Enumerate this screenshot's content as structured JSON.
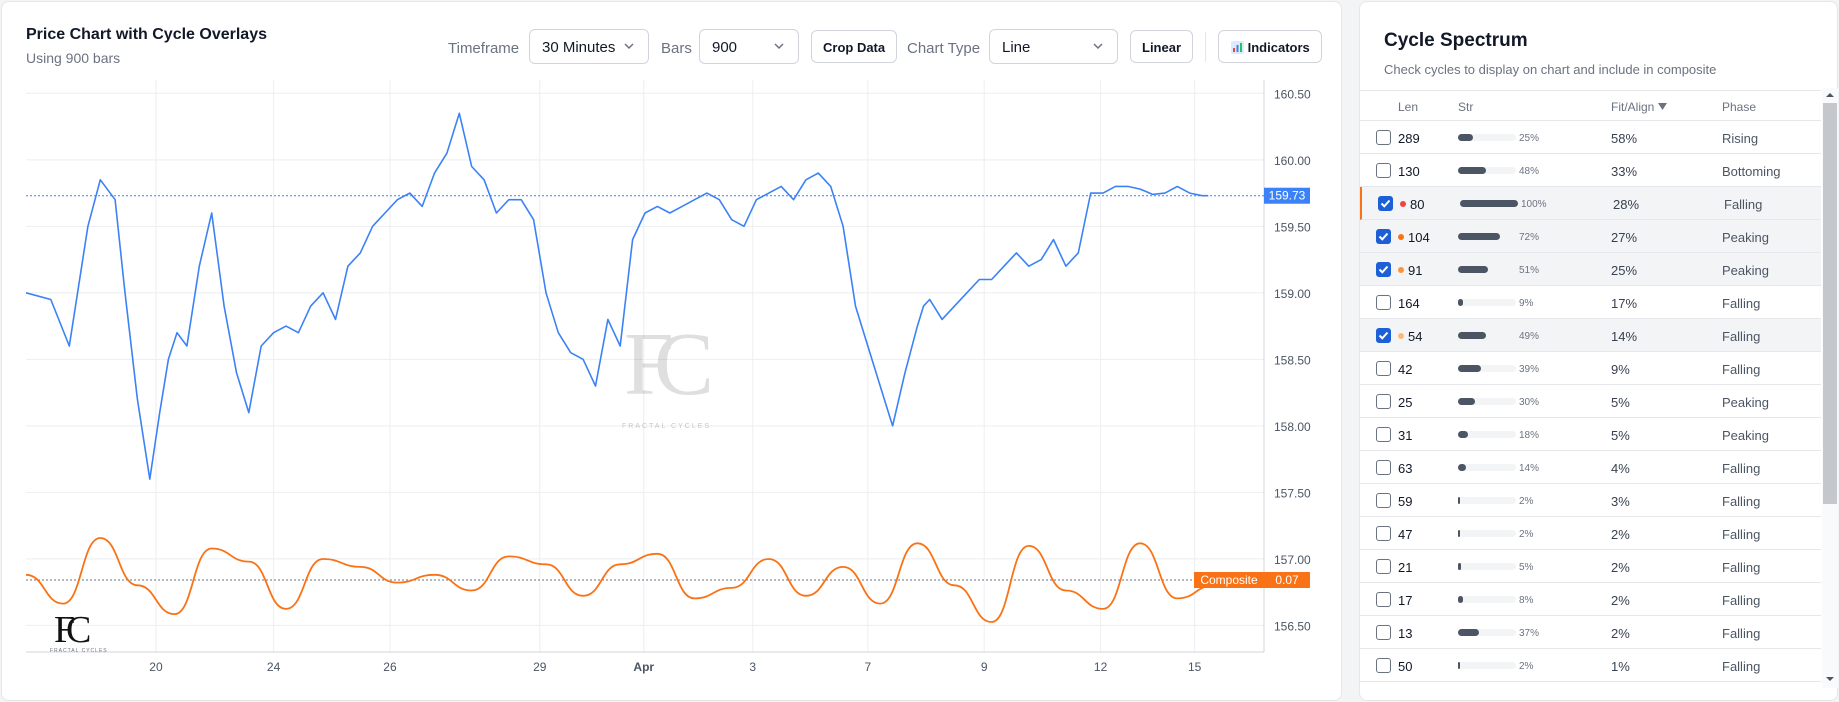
{
  "chart_panel": {
    "title": "Price Chart with Cycle Overlays",
    "subtitle": "Using 900 bars",
    "timeframe_label": "Timeframe",
    "timeframe_value": "30 Minutes",
    "bars_label": "Bars",
    "bars_value": "900",
    "crop_button": "Crop Data",
    "chart_type_label": "Chart Type",
    "chart_type_value": "Line",
    "scale_button": "Linear",
    "indicators_button": "Indicators",
    "indicators_icon": "bar-chart-icon",
    "watermark_text": "FRACTAL CYCLES",
    "logo_text": "FRACTAL CYCLES"
  },
  "chart_data": {
    "type": "line",
    "x_axis_type": "date",
    "x_ticks": [
      "20",
      "24",
      "26",
      "29",
      "Apr",
      "3",
      "7",
      "9",
      "12",
      "15"
    ],
    "y_ticks": [
      "160.50",
      "160.00",
      "159.50",
      "159.00",
      "158.50",
      "158.00",
      "157.50",
      "157.00",
      "156.50"
    ],
    "ylim": [
      156.3,
      160.6
    ],
    "grid": true,
    "series": [
      {
        "color": "#3b82f6",
        "last_value_label": "159.73",
        "x": [
          0.0,
          0.02,
          0.035,
          0.05,
          0.06,
          0.072,
          0.08,
          0.09,
          0.1,
          0.108,
          0.115,
          0.122,
          0.13,
          0.14,
          0.15,
          0.16,
          0.17,
          0.18,
          0.19,
          0.2,
          0.21,
          0.22,
          0.23,
          0.24,
          0.25,
          0.26,
          0.27,
          0.28,
          0.29,
          0.3,
          0.31,
          0.32,
          0.33,
          0.34,
          0.35,
          0.36,
          0.37,
          0.38,
          0.39,
          0.4,
          0.41,
          0.42,
          0.43,
          0.44,
          0.45,
          0.46,
          0.47,
          0.48,
          0.49,
          0.5,
          0.51,
          0.52,
          0.53,
          0.54,
          0.55,
          0.56,
          0.57,
          0.58,
          0.59,
          0.6,
          0.61,
          0.62,
          0.63,
          0.64,
          0.65,
          0.66,
          0.67,
          0.68,
          0.69,
          0.7,
          0.71,
          0.72,
          0.725,
          0.73,
          0.74,
          0.75,
          0.76,
          0.77,
          0.78,
          0.79,
          0.8,
          0.81,
          0.82,
          0.83,
          0.84,
          0.85,
          0.86,
          0.87,
          0.88,
          0.89,
          0.9,
          0.91,
          0.92,
          0.93,
          0.94,
          0.95,
          0.955
        ],
        "y": [
          159.0,
          158.95,
          158.6,
          159.5,
          159.85,
          159.7,
          159.0,
          158.2,
          157.6,
          158.1,
          158.5,
          158.7,
          158.6,
          159.2,
          159.6,
          158.9,
          158.4,
          158.1,
          158.6,
          158.7,
          158.75,
          158.7,
          158.9,
          159.0,
          158.8,
          159.2,
          159.3,
          159.5,
          159.6,
          159.7,
          159.75,
          159.65,
          159.9,
          160.05,
          160.35,
          159.95,
          159.85,
          159.6,
          159.7,
          159.7,
          159.55,
          159.0,
          158.7,
          158.55,
          158.5,
          158.3,
          158.8,
          158.6,
          159.4,
          159.6,
          159.65,
          159.6,
          159.65,
          159.7,
          159.75,
          159.7,
          159.55,
          159.5,
          159.7,
          159.75,
          159.8,
          159.7,
          159.85,
          159.9,
          159.8,
          159.5,
          158.9,
          158.6,
          158.3,
          158.0,
          158.4,
          158.75,
          158.9,
          158.95,
          158.8,
          158.9,
          159.0,
          159.1,
          159.1,
          159.2,
          159.3,
          159.2,
          159.25,
          159.4,
          159.2,
          159.3,
          159.75,
          159.75,
          159.8,
          159.8,
          159.78,
          159.74,
          159.75,
          159.8,
          159.75,
          159.73,
          159.73
        ]
      },
      {
        "name": "Composite",
        "color": "#f97316",
        "last_value_label": "0.07",
        "x": [
          0.0,
          0.03,
          0.06,
          0.09,
          0.12,
          0.15,
          0.18,
          0.21,
          0.24,
          0.27,
          0.3,
          0.33,
          0.36,
          0.39,
          0.42,
          0.45,
          0.48,
          0.51,
          0.54,
          0.57,
          0.6,
          0.63,
          0.66,
          0.69,
          0.72,
          0.75,
          0.78,
          0.81,
          0.84,
          0.87,
          0.9,
          0.93,
          0.96,
          1.0
        ],
        "y": [
          0.2,
          -0.9,
          1.6,
          -0.2,
          -1.3,
          1.2,
          0.7,
          -1.1,
          0.8,
          0.5,
          -0.1,
          0.2,
          -0.4,
          0.9,
          0.6,
          -0.6,
          0.6,
          1.0,
          -0.7,
          -0.3,
          0.8,
          -0.6,
          0.5,
          -0.9,
          1.4,
          -0.2,
          -1.6,
          1.3,
          -0.4,
          -1.1,
          1.4,
          -0.7,
          -0.2,
          0.07
        ]
      }
    ]
  },
  "spectrum": {
    "title": "Cycle Spectrum",
    "subtitle": "Check cycles to display on chart and include in composite",
    "headers": {
      "len": "Len",
      "str": "Str",
      "fit": "Fit/Align",
      "sort_icon": "sort-desc-icon",
      "phase": "Phase"
    },
    "rows": [
      {
        "len": "289",
        "str_pct": "25%",
        "str_value": 0.25,
        "fit": "58%",
        "phase": "Rising",
        "checked": false,
        "dot": ""
      },
      {
        "len": "130",
        "str_pct": "48%",
        "str_value": 0.48,
        "fit": "33%",
        "phase": "Bottoming",
        "checked": false,
        "dot": ""
      },
      {
        "len": "80",
        "str_pct": "100%",
        "str_value": 1.0,
        "fit": "28%",
        "phase": "Falling",
        "checked": true,
        "dot": "#ef4444",
        "highlight": true
      },
      {
        "len": "104",
        "str_pct": "72%",
        "str_value": 0.72,
        "fit": "27%",
        "phase": "Peaking",
        "checked": true,
        "dot": "#f97316"
      },
      {
        "len": "91",
        "str_pct": "51%",
        "str_value": 0.51,
        "fit": "25%",
        "phase": "Peaking",
        "checked": true,
        "dot": "#fb923c"
      },
      {
        "len": "164",
        "str_pct": "9%",
        "str_value": 0.09,
        "fit": "17%",
        "phase": "Falling",
        "checked": false,
        "dot": ""
      },
      {
        "len": "54",
        "str_pct": "49%",
        "str_value": 0.49,
        "fit": "14%",
        "phase": "Falling",
        "checked": true,
        "dot": "#fdba74"
      },
      {
        "len": "42",
        "str_pct": "39%",
        "str_value": 0.39,
        "fit": "9%",
        "phase": "Falling",
        "checked": false,
        "dot": ""
      },
      {
        "len": "25",
        "str_pct": "30%",
        "str_value": 0.3,
        "fit": "5%",
        "phase": "Peaking",
        "checked": false,
        "dot": ""
      },
      {
        "len": "31",
        "str_pct": "18%",
        "str_value": 0.18,
        "fit": "5%",
        "phase": "Peaking",
        "checked": false,
        "dot": ""
      },
      {
        "len": "63",
        "str_pct": "14%",
        "str_value": 0.14,
        "fit": "4%",
        "phase": "Falling",
        "checked": false,
        "dot": ""
      },
      {
        "len": "59",
        "str_pct": "2%",
        "str_value": 0.02,
        "fit": "3%",
        "phase": "Falling",
        "checked": false,
        "dot": ""
      },
      {
        "len": "47",
        "str_pct": "2%",
        "str_value": 0.02,
        "fit": "2%",
        "phase": "Falling",
        "checked": false,
        "dot": ""
      },
      {
        "len": "21",
        "str_pct": "5%",
        "str_value": 0.05,
        "fit": "2%",
        "phase": "Falling",
        "checked": false,
        "dot": ""
      },
      {
        "len": "17",
        "str_pct": "8%",
        "str_value": 0.08,
        "fit": "2%",
        "phase": "Falling",
        "checked": false,
        "dot": ""
      },
      {
        "len": "13",
        "str_pct": "37%",
        "str_value": 0.37,
        "fit": "2%",
        "phase": "Falling",
        "checked": false,
        "dot": ""
      },
      {
        "len": "50",
        "str_pct": "2%",
        "str_value": 0.02,
        "fit": "1%",
        "phase": "Falling",
        "checked": false,
        "dot": ""
      }
    ]
  },
  "colors": {
    "price_line": "#3b82f6",
    "composite_line": "#f97316",
    "checkbox_checked": "#1d5fd6",
    "highlight_border": "#f97316"
  }
}
